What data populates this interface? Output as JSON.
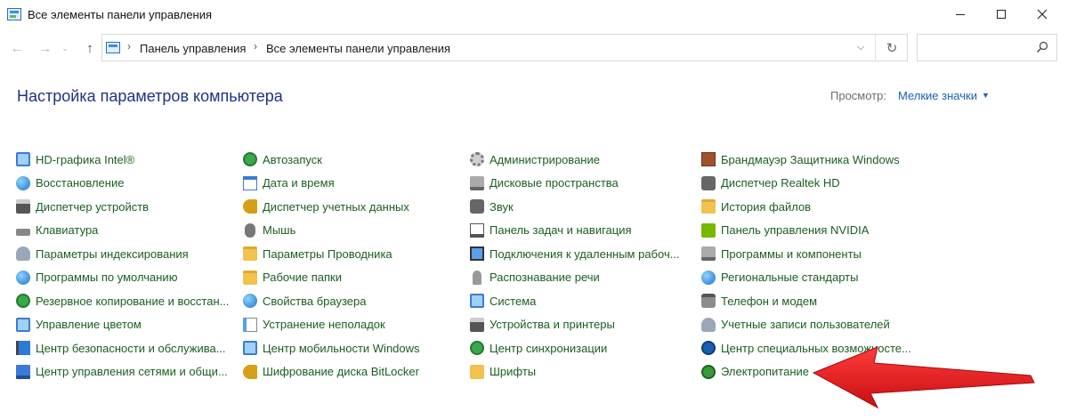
{
  "window": {
    "title": "Все элементы панели управления"
  },
  "navigation": {
    "back_icon": "arrow-left-icon",
    "forward_icon": "arrow-right-icon",
    "recent_icon": "chevron-down-icon",
    "up_icon": "arrow-up-icon",
    "breadcrumbs": [
      "Панель управления",
      "Все элементы панели управления"
    ],
    "refresh_icon": "refresh-icon",
    "search_placeholder": ""
  },
  "header": {
    "title": "Настройка параметров компьютера",
    "view_label": "Просмотр:",
    "view_value": "Мелкие значки"
  },
  "columns": [
    {
      "items": [
        {
          "label": "HD-графика Intel®",
          "icon": "intel-graphics-icon"
        },
        {
          "label": "Восстановление",
          "icon": "recovery-icon"
        },
        {
          "label": "Диспетчер устройств",
          "icon": "device-manager-icon"
        },
        {
          "label": "Клавиатура",
          "icon": "keyboard-icon"
        },
        {
          "label": "Параметры индексирования",
          "icon": "indexing-icon"
        },
        {
          "label": "Программы по умолчанию",
          "icon": "default-programs-icon"
        },
        {
          "label": "Резервное копирование и восстан...",
          "icon": "backup-icon"
        },
        {
          "label": "Управление цветом",
          "icon": "color-management-icon"
        },
        {
          "label": "Центр безопасности и обслужива...",
          "icon": "security-center-icon"
        },
        {
          "label": "Центр управления сетями и общи...",
          "icon": "network-center-icon"
        }
      ]
    },
    {
      "items": [
        {
          "label": "Автозапуск",
          "icon": "autoplay-icon"
        },
        {
          "label": "Дата и время",
          "icon": "date-time-icon"
        },
        {
          "label": "Диспетчер учетных данных",
          "icon": "credential-manager-icon"
        },
        {
          "label": "Мышь",
          "icon": "mouse-icon"
        },
        {
          "label": "Параметры Проводника",
          "icon": "explorer-options-icon"
        },
        {
          "label": "Рабочие папки",
          "icon": "work-folders-icon"
        },
        {
          "label": "Свойства браузера",
          "icon": "internet-options-icon"
        },
        {
          "label": "Устранение неполадок",
          "icon": "troubleshooting-icon"
        },
        {
          "label": "Центр мобильности Windows",
          "icon": "mobility-center-icon"
        },
        {
          "label": "Шифрование диска BitLocker",
          "icon": "bitlocker-icon"
        }
      ]
    },
    {
      "items": [
        {
          "label": "Администрирование",
          "icon": "administrative-tools-icon"
        },
        {
          "label": "Дисковые пространства",
          "icon": "storage-spaces-icon"
        },
        {
          "label": "Звук",
          "icon": "sound-icon"
        },
        {
          "label": "Панель задач и навигация",
          "icon": "taskbar-icon"
        },
        {
          "label": "Подключения к удаленным рабоч...",
          "icon": "remote-desktop-icon"
        },
        {
          "label": "Распознавание речи",
          "icon": "speech-recognition-icon"
        },
        {
          "label": "Система",
          "icon": "system-icon"
        },
        {
          "label": "Устройства и принтеры",
          "icon": "devices-printers-icon"
        },
        {
          "label": "Центр синхронизации",
          "icon": "sync-center-icon"
        },
        {
          "label": "Шрифты",
          "icon": "fonts-icon"
        }
      ]
    },
    {
      "items": [
        {
          "label": "Брандмауэр Защитника Windows",
          "icon": "firewall-icon"
        },
        {
          "label": "Диспетчер Realtek HD",
          "icon": "realtek-icon"
        },
        {
          "label": "История файлов",
          "icon": "file-history-icon"
        },
        {
          "label": "Панель управления NVIDIA",
          "icon": "nvidia-icon"
        },
        {
          "label": "Программы и компоненты",
          "icon": "programs-features-icon"
        },
        {
          "label": "Региональные стандарты",
          "icon": "region-icon"
        },
        {
          "label": "Телефон и модем",
          "icon": "phone-modem-icon"
        },
        {
          "label": "Учетные записи пользователей",
          "icon": "user-accounts-icon"
        },
        {
          "label": "Центр специальных возможносте...",
          "icon": "ease-of-access-icon"
        },
        {
          "label": "Электропитание",
          "icon": "power-options-icon"
        }
      ]
    }
  ],
  "annotation": {
    "arrow_color": "#e8141c",
    "arrow_icon": "red-arrow-pointer-icon"
  }
}
